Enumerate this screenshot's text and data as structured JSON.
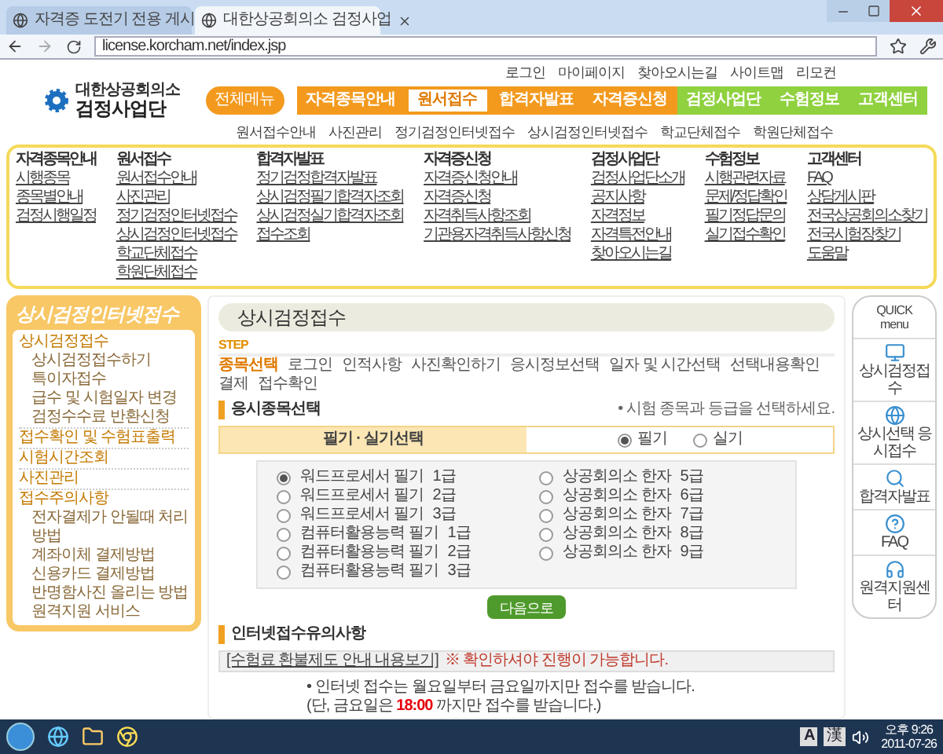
{
  "browser": {
    "tabs": [
      {
        "title": "자격증 도전기 전용 게시",
        "selected": false
      },
      {
        "title": "대한상공회의소 검정사업",
        "selected": true
      }
    ],
    "url": "license.korcham.net/index.jsp"
  },
  "header": {
    "utility_links": [
      "로그인",
      "마이페이지",
      "찾아오시는길",
      "사이트맵",
      "리모컨"
    ],
    "logo": {
      "line_1": "대한상공회의소",
      "line_2": "검정사업단"
    },
    "all_menu": "전체메뉴",
    "nav": [
      {
        "label": "자격종목안내",
        "kind": "primary",
        "selected": false
      },
      {
        "label": "원서접수",
        "kind": "primary",
        "selected": true
      },
      {
        "label": "합격자발표",
        "kind": "primary",
        "selected": false
      },
      {
        "label": "자격증신청",
        "kind": "primary",
        "selected": false
      },
      {
        "label": "검정사업단",
        "kind": "secondary",
        "selected": false
      },
      {
        "label": "수험정보",
        "kind": "secondary",
        "selected": false
      },
      {
        "label": "고객센터",
        "kind": "secondary",
        "selected": false
      }
    ],
    "subnav": [
      "원서접수안내",
      "사진관리",
      "정기검정인터넷접수",
      "상시검정인터넷접수",
      "학교단체접수",
      "학원단체접수"
    ]
  },
  "mega_menu": [
    {
      "heading": "자격종목안내",
      "items": [
        "시행종목",
        "종목별안내",
        "검정시행일정"
      ]
    },
    {
      "heading": "원서접수",
      "items": [
        "원서접수안내",
        "사진관리",
        "정기검정인터넷접수",
        "상시검정인터넷접수",
        "학교단체접수",
        "학원단체접수"
      ]
    },
    {
      "heading": "합격자발표",
      "items": [
        "정기검정합격자발표",
        "상시검정필기합격자조회",
        "상시검정실기합격자조회",
        "접수조회"
      ]
    },
    {
      "heading": "자격증신청",
      "items": [
        "자격증신청안내",
        "자격증신청",
        "자격취득사항조회",
        "기관용자격취득사항신청"
      ]
    },
    {
      "heading": "검정사업단",
      "items": [
        "검정사업단소개",
        "공지사항",
        "자격정보",
        "자격특전안내",
        "찾아오시는길"
      ]
    },
    {
      "heading": "수험정보",
      "items": [
        "시행관련자료",
        "문제/정답확인",
        "필기정답문의",
        "실기접수확인"
      ]
    },
    {
      "heading": "고객센터",
      "items": [
        "FAQ",
        "상담게시판",
        "전국상공회의소찾기",
        "전국시험장찾기",
        "도움말"
      ]
    }
  ],
  "sidebar": {
    "title": "상시검정인터넷접수",
    "items": [
      {
        "label": "상시검정접수",
        "children": [
          {
            "label": "상시검정접수하기"
          },
          {
            "label": "특이자접수"
          },
          {
            "label": "급수 및 시험일자 변경"
          },
          {
            "label": "검정수수료 반환신청"
          }
        ]
      },
      {
        "label": "접수확인 및 수험표출력"
      },
      {
        "label": "시험시간조회"
      },
      {
        "label": "사진관리"
      },
      {
        "label": "접수주의사항",
        "children": [
          {
            "label": "전자결제가 안될때 처리방법"
          },
          {
            "label": "계좌이체 결제방법"
          },
          {
            "label": "신용카드 결제방법"
          },
          {
            "label": "반명함사진 올리는 방법"
          },
          {
            "label": "원격지원 서비스"
          }
        ]
      }
    ]
  },
  "content": {
    "title": "상시검정접수",
    "step_label": "STEP",
    "steps": [
      {
        "label": "종목선택",
        "selected": true
      },
      {
        "label": "로그인",
        "selected": false
      },
      {
        "label": "인적사항",
        "selected": false
      },
      {
        "label": "사진확인하기",
        "selected": false
      },
      {
        "label": "응시정보선택",
        "selected": false
      },
      {
        "label": "일자 및 시간선택",
        "selected": false
      },
      {
        "label": "선택내용확인",
        "selected": false
      },
      {
        "label": "결제",
        "selected": false
      },
      {
        "label": "접수확인",
        "selected": false
      }
    ],
    "exam_section": {
      "heading": "응시종목선택",
      "hint": "• 시험 종목과 등급을 선택하세요.",
      "selector_label": "필기 · 실기선택",
      "type_options": [
        {
          "label": "필기",
          "selected": true
        },
        {
          "label": "실기",
          "selected": false
        }
      ],
      "exams": [
        {
          "name": "워드프로세서 필기",
          "grade": "1급",
          "selected": true
        },
        {
          "name": "워드프로세서 필기",
          "grade": "2급",
          "selected": false
        },
        {
          "name": "워드프로세서 필기",
          "grade": "3급",
          "selected": false
        },
        {
          "name": "컴퓨터활용능력 필기",
          "grade": "1급",
          "selected": false
        },
        {
          "name": "컴퓨터활용능력 필기",
          "grade": "2급",
          "selected": false
        },
        {
          "name": "컴퓨터활용능력 필기",
          "grade": "3급",
          "selected": false
        },
        {
          "name": "상공회의소 한자",
          "grade": "5급",
          "selected": false
        },
        {
          "name": "상공회의소 한자",
          "grade": "6급",
          "selected": false
        },
        {
          "name": "상공회의소 한자",
          "grade": "7급",
          "selected": false
        },
        {
          "name": "상공회의소 한자",
          "grade": "8급",
          "selected": false
        },
        {
          "name": "상공회의소 한자",
          "grade": "9급",
          "selected": false
        }
      ],
      "next_button": "다음으로"
    },
    "notice_section": {
      "heading": "인터넷접수유의사항",
      "link": "[수험료 환불제도 안내 내용보기]",
      "warning": "※ 확인하셔야 진행이 가능합니다.",
      "lines": [
        "• 인터넷 접수는 월요일부터 금요일까지만 접수를 받습니다.",
        "(단, 금요일은 **18:00** 까지만 접수를 받습니다.)"
      ]
    }
  },
  "quick_menu": {
    "title_1": "QUICK",
    "title_2": "menu",
    "items": [
      "상시검정접수",
      "상시선택 응시접수",
      "합격자발표",
      "FAQ",
      "원격지원센터"
    ]
  },
  "taskbar": {
    "ime_1": "A",
    "ime_2": "漢",
    "time": "오후 9:26",
    "date": "2011-07-26"
  }
}
